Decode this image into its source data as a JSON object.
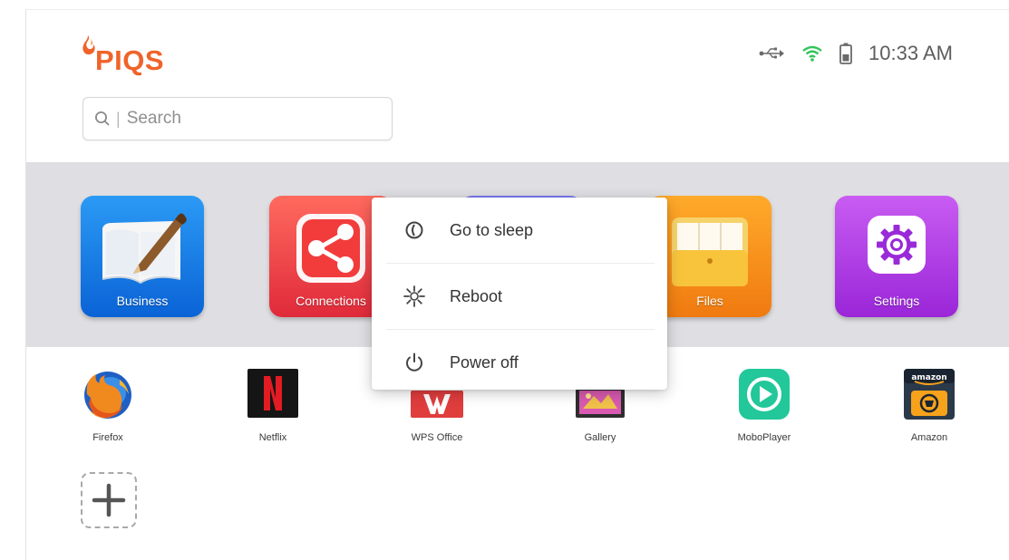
{
  "header": {
    "brand": "PIQS",
    "clock": "10:33 AM",
    "colors": {
      "brand": "#f0632a",
      "wifi": "#33c45a"
    }
  },
  "search": {
    "placeholder": "Search",
    "icon": "search-icon"
  },
  "tiles": [
    {
      "label": "Business",
      "icon": "notebook-pen-icon",
      "color": "#1877e6"
    },
    {
      "label": "Connections",
      "icon": "share-icon",
      "color": "#f0413f"
    },
    {
      "label": "",
      "icon": "hidden-tile",
      "color": "#6a63ea"
    },
    {
      "label": "Files",
      "icon": "folder-icon",
      "color": "#f88f1a"
    },
    {
      "label": "Settings",
      "icon": "gear-icon",
      "color": "#b33fe6"
    }
  ],
  "apps": [
    {
      "label": "Firefox",
      "icon": "firefox-icon"
    },
    {
      "label": "Netflix",
      "icon": "netflix-icon"
    },
    {
      "label": "WPS Office",
      "icon": "wps-office-icon"
    },
    {
      "label": "Gallery",
      "icon": "gallery-icon"
    },
    {
      "label": "MoboPlayer",
      "icon": "moboplayer-icon"
    },
    {
      "label": "Amazon",
      "icon": "amazon-icon"
    }
  ],
  "add_tile": {
    "icon": "plus-icon"
  },
  "power_menu": {
    "items": [
      {
        "label": "Go to sleep",
        "icon": "sleep-icon"
      },
      {
        "label": "Reboot",
        "icon": "reboot-icon"
      },
      {
        "label": "Power off",
        "icon": "power-icon"
      }
    ]
  }
}
